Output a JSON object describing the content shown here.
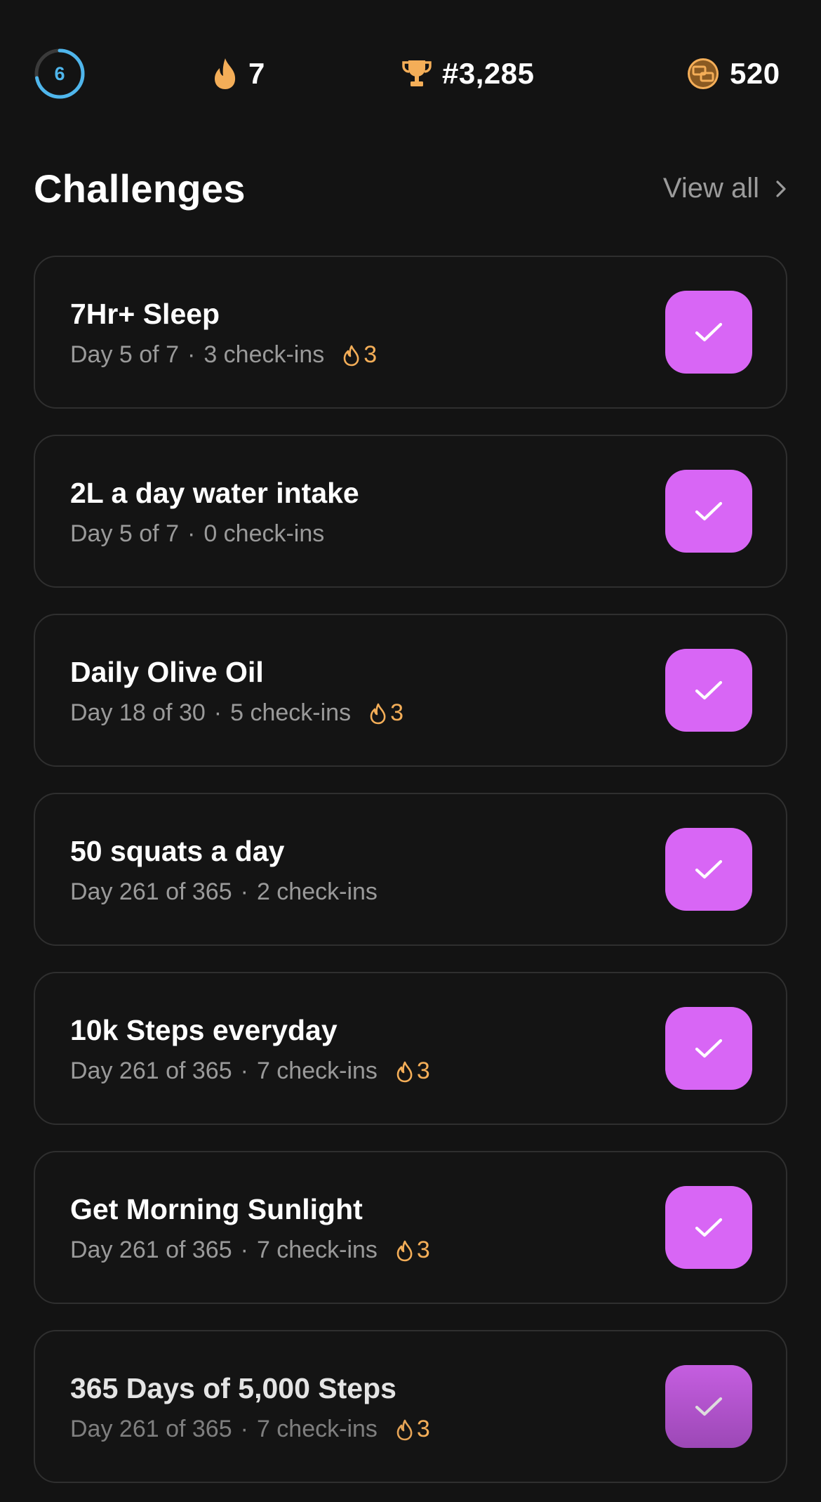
{
  "stats": {
    "level": "6",
    "level_progress": 0.72,
    "streak": "7",
    "rank": "#3,285",
    "coins": "520"
  },
  "header": {
    "title": "Challenges",
    "view_all_label": "View all"
  },
  "challenges": [
    {
      "title": "7Hr+ Sleep",
      "day": "Day 5 of 7",
      "checkins": "3 check-ins",
      "flame": "3",
      "show_flame": true
    },
    {
      "title": "2L a day water intake",
      "day": "Day 5 of 7",
      "checkins": "0 check-ins",
      "flame": "",
      "show_flame": false
    },
    {
      "title": "Daily Olive Oil",
      "day": "Day 18 of 30",
      "checkins": "5 check-ins",
      "flame": "3",
      "show_flame": true
    },
    {
      "title": "50 squats a day",
      "day": "Day 261 of 365",
      "checkins": "2 check-ins",
      "flame": "",
      "show_flame": false
    },
    {
      "title": "10k Steps everyday",
      "day": "Day 261 of 365",
      "checkins": "7 check-ins",
      "flame": "3",
      "show_flame": true
    },
    {
      "title": "Get Morning Sunlight",
      "day": "Day 261 of 365",
      "checkins": "7 check-ins",
      "flame": "3",
      "show_flame": true
    },
    {
      "title": "365 Days of 5,000 Steps",
      "day": "Day 261 of 365",
      "checkins": "7 check-ins",
      "flame": "3",
      "show_flame": true
    }
  ],
  "separator": "·",
  "colors": {
    "background": "#131313",
    "accent": "#d866f5",
    "ring": "#4fb6ec",
    "flame": "#f4ae58",
    "muted_text": "#9a9a9a",
    "card_border": "#2f2f2f"
  },
  "icons": {
    "level": "progress-ring",
    "streak": "flame-icon",
    "rank": "trophy-icon",
    "coins": "coin-icon",
    "view_all": "chevron-right-icon",
    "check": "check-icon"
  }
}
